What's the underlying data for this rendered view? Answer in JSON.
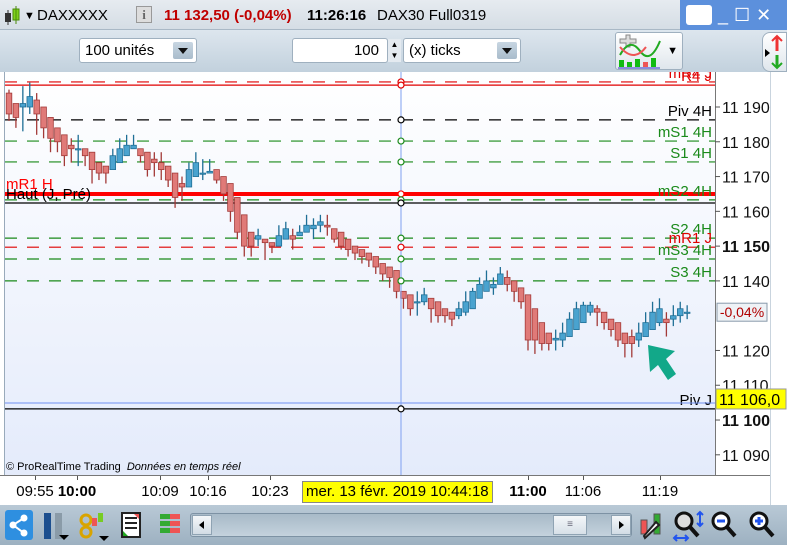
{
  "titlebar": {
    "symbol": "DAXXXXX",
    "price": "11 132,50 (-0,04%)",
    "time": "11:26:16",
    "instrument": "DAX30 Full0319",
    "icons": [
      "candlestick-icon",
      "info-icon",
      "keyboard-icon",
      "minimize-icon",
      "maximize-icon",
      "close-icon"
    ],
    "price_color": "#c00000",
    "winctl_color": "#5c90dc"
  },
  "toolbar": {
    "units": "100 unités",
    "tick_count": "100",
    "tick_mode": "(x) ticks"
  },
  "chart_data": {
    "type": "candlestick",
    "ylim": [
      11087,
      11198
    ],
    "yticks": [
      {
        "v": 11190,
        "t": "11 190"
      },
      {
        "v": 11180,
        "t": "11 180"
      },
      {
        "v": 11170,
        "t": "11 170"
      },
      {
        "v": 11160,
        "t": "11 160"
      },
      {
        "v": 11150,
        "t": "11 150",
        "bold": true
      },
      {
        "v": 11140,
        "t": "11 140"
      },
      {
        "v": 11120,
        "t": "11 120"
      },
      {
        "v": 11110,
        "t": "11 110"
      },
      {
        "v": 11100,
        "t": "11 100",
        "bold": true
      },
      {
        "v": 11090,
        "t": "11 090"
      }
    ],
    "xticks": [
      {
        "t": "09:55"
      },
      {
        "t": "10:00",
        "bold": true
      },
      {
        "t": "10:09"
      },
      {
        "t": "10:16"
      },
      {
        "t": "10:23"
      },
      {
        "t": "11:00",
        "bold": true
      },
      {
        "t": "11:06"
      },
      {
        "t": "11:19"
      }
    ],
    "cursor_time": "mer. 13 févr. 2019 10:44:18",
    "up_color": "#4aa3cf",
    "down_color": "#e07a78",
    "candles_ohlc": [
      [
        11194,
        11195,
        11186,
        11188
      ],
      [
        11191,
        11191,
        11184,
        11187
      ],
      [
        11190,
        11196,
        11183,
        11191
      ],
      [
        11190,
        11197,
        11188,
        11193
      ],
      [
        11192,
        11194,
        11182,
        11188
      ],
      [
        11190,
        11190,
        11181,
        11184
      ],
      [
        11187,
        11187,
        11177,
        11181
      ],
      [
        11184,
        11184,
        11177,
        11180
      ],
      [
        11182,
        11182,
        11173,
        11176
      ],
      [
        11179,
        11181,
        11174,
        11178
      ],
      [
        11178,
        11182,
        11173,
        11178
      ],
      [
        11178,
        11178,
        11173,
        11176
      ],
      [
        11177,
        11177,
        11168,
        11172
      ],
      [
        11174,
        11174,
        11169,
        11171
      ],
      [
        11173,
        11173,
        11168,
        11171
      ],
      [
        11172,
        11178,
        11172,
        11176
      ],
      [
        11174,
        11181,
        11174,
        11178
      ],
      [
        11176,
        11182,
        11176,
        11179
      ],
      [
        11178,
        11182,
        11178,
        11179
      ],
      [
        11178,
        11178,
        11174,
        11176
      ],
      [
        11177,
        11177,
        11170,
        11172
      ],
      [
        11175,
        11177,
        11170,
        11174
      ],
      [
        11174,
        11177,
        11169,
        11172
      ],
      [
        11173,
        11173,
        11167,
        11169
      ],
      [
        11171,
        11171,
        11161,
        11164
      ],
      [
        11168,
        11170,
        11163,
        11167
      ],
      [
        11167,
        11174,
        11167,
        11172
      ],
      [
        11170,
        11177,
        11170,
        11174
      ],
      [
        11171,
        11175,
        11169,
        11171
      ],
      [
        11171,
        11175,
        11171,
        11171.5
      ],
      [
        11172,
        11172,
        11168,
        11169
      ],
      [
        11170,
        11170,
        11163,
        11165
      ],
      [
        11168,
        11168,
        11157,
        11160
      ],
      [
        11164,
        11164,
        11152,
        11154
      ],
      [
        11159,
        11159,
        11147,
        11150
      ],
      [
        11154,
        11154,
        11147,
        11150
      ],
      [
        11152,
        11155,
        11150,
        11153
      ],
      [
        11152,
        11152,
        11146,
        11151
      ],
      [
        11151,
        11151,
        11148,
        11150
      ],
      [
        11150,
        11156,
        11150,
        11153
      ],
      [
        11152,
        11157,
        11152,
        11155
      ],
      [
        11153,
        11155,
        11149,
        11152
      ],
      [
        11153,
        11156,
        11153,
        11154
      ],
      [
        11154,
        11159,
        11154,
        11156
      ],
      [
        11155,
        11158,
        11152,
        11156
      ],
      [
        11156,
        11159,
        11154,
        11157
      ],
      [
        11156,
        11159,
        11153,
        11155.5
      ],
      [
        11155,
        11155,
        11151,
        11152
      ],
      [
        11154,
        11154,
        11149,
        11150
      ],
      [
        11152,
        11152,
        11147,
        11149
      ],
      [
        11150,
        11150,
        11146,
        11148
      ],
      [
        11149,
        11149,
        11145,
        11147
      ],
      [
        11148,
        11148,
        11144,
        11146
      ],
      [
        11147,
        11147,
        11142,
        11144
      ],
      [
        11145,
        11145,
        11140,
        11142
      ],
      [
        11144,
        11144,
        11138,
        11141
      ],
      [
        11143,
        11143,
        11135,
        11137
      ],
      [
        11137,
        11137,
        11132,
        11135
      ],
      [
        11136,
        11136,
        11130,
        11132
      ],
      [
        11134,
        11137,
        11130,
        11134
      ],
      [
        11134,
        11138,
        11133,
        11136
      ],
      [
        11135,
        11135,
        11128,
        11132
      ],
      [
        11134,
        11134,
        11128,
        11130
      ],
      [
        11132,
        11132,
        11128,
        11130
      ],
      [
        11131,
        11131,
        11127,
        11129
      ],
      [
        11130,
        11134,
        11129,
        11132
      ],
      [
        11131,
        11137,
        11130,
        11134
      ],
      [
        11132,
        11138,
        11132,
        11137
      ],
      [
        11135,
        11141,
        11135,
        11139
      ],
      [
        11137,
        11143,
        11137,
        11140
      ],
      [
        11138,
        11141,
        11136,
        11139
      ],
      [
        11139,
        11144,
        11139,
        11142
      ],
      [
        11141,
        11143,
        11137,
        11139
      ],
      [
        11140,
        11140,
        11134,
        11137
      ],
      [
        11138,
        11138,
        11132,
        11134
      ],
      [
        11136,
        11136,
        11120,
        11123
      ],
      [
        11132,
        11132,
        11119,
        11123
      ],
      [
        11128,
        11128,
        11120,
        11122
      ],
      [
        11125,
        11125,
        11120,
        11122
      ],
      [
        11123,
        11126,
        11120,
        11123.5
      ],
      [
        11123,
        11128,
        11121,
        11125
      ],
      [
        11124,
        11131,
        11124,
        11129
      ],
      [
        11126,
        11134,
        11126,
        11132
      ],
      [
        11128,
        11134,
        11128,
        11133
      ],
      [
        11131,
        11134,
        11130,
        11133
      ],
      [
        11132,
        11133,
        11127,
        11131
      ],
      [
        11131,
        11131,
        11126,
        11128
      ],
      [
        11129,
        11129,
        11124,
        11126
      ],
      [
        11128,
        11128,
        11121,
        11123
      ],
      [
        11125,
        11125,
        11118,
        11122
      ],
      [
        11124,
        11126,
        11118,
        11122
      ],
      [
        11123,
        11128,
        11121,
        11125
      ],
      [
        11124,
        11131,
        11124,
        11128
      ],
      [
        11126,
        11134,
        11126,
        11131
      ],
      [
        11128,
        11135,
        11127,
        11132
      ],
      [
        11129,
        11131,
        11124,
        11128
      ],
      [
        11129,
        11133,
        11127,
        11130
      ],
      [
        11130,
        11134,
        11128,
        11132
      ],
      [
        11131,
        11133,
        11129,
        11131
      ]
    ],
    "levels": [
      {
        "label": "mR4 J",
        "value": 11197.2,
        "color": "#e00000",
        "style": "dashed",
        "side": "right"
      },
      {
        "label": "R4 J",
        "value": 11196.3,
        "color": "#e00000",
        "style": "solid",
        "side": "right"
      },
      {
        "label": "Piv 4H",
        "value": 11186.3,
        "color": "#000000",
        "style": "dashed",
        "side": "right"
      },
      {
        "label": "mS1 4H",
        "value": 11180.2,
        "color": "#1a8a1a",
        "style": "dashed",
        "side": "right"
      },
      {
        "label": "S1 4H",
        "value": 11174.2,
        "color": "#1a8a1a",
        "style": "dashed",
        "side": "right"
      },
      {
        "label": "mR1 H",
        "value": 11165.0,
        "color": "#ff0000",
        "style": "thick",
        "side": "left"
      },
      {
        "label": "mS2 4H",
        "value": 11163.3,
        "color": "#1a8a1a",
        "style": "dashed",
        "side": "right"
      },
      {
        "label": "Haut (J, Pré)",
        "value": 11162.4,
        "color": "#000000",
        "style": "solid",
        "side": "left"
      },
      {
        "label": "S2 4H",
        "value": 11152.3,
        "color": "#1a8a1a",
        "style": "dashed",
        "side": "right"
      },
      {
        "label": "mR1 J",
        "value": 11149.7,
        "color": "#e00000",
        "style": "dashed",
        "side": "right"
      },
      {
        "label": "mS3 4H",
        "value": 11146.3,
        "color": "#1a8a1a",
        "style": "dashed",
        "side": "right"
      },
      {
        "label": "S3 4H",
        "value": 11140.0,
        "color": "#1a8a1a",
        "style": "dashed",
        "side": "right"
      },
      {
        "label": "Piv J",
        "value": 11103.2,
        "color": "#000000",
        "style": "solid",
        "side": "right"
      }
    ],
    "blue_line": 11104.9,
    "price_tag": "11 106,0",
    "change_tag": "-0,04%",
    "change_value": 11131
  },
  "footer": {
    "copyright": "© ProRealTime Trading",
    "realtime": "Données en temps réel"
  },
  "bottombar": {
    "icons": [
      "share-icon",
      "layout-icon",
      "link-icon",
      "drawing-list-icon",
      "order-book-icon",
      "scroll-left-icon",
      "scroll-right-icon",
      "chart-settings-icon",
      "auto-zoom-icon",
      "zoom-out-icon",
      "zoom-in-icon"
    ]
  }
}
